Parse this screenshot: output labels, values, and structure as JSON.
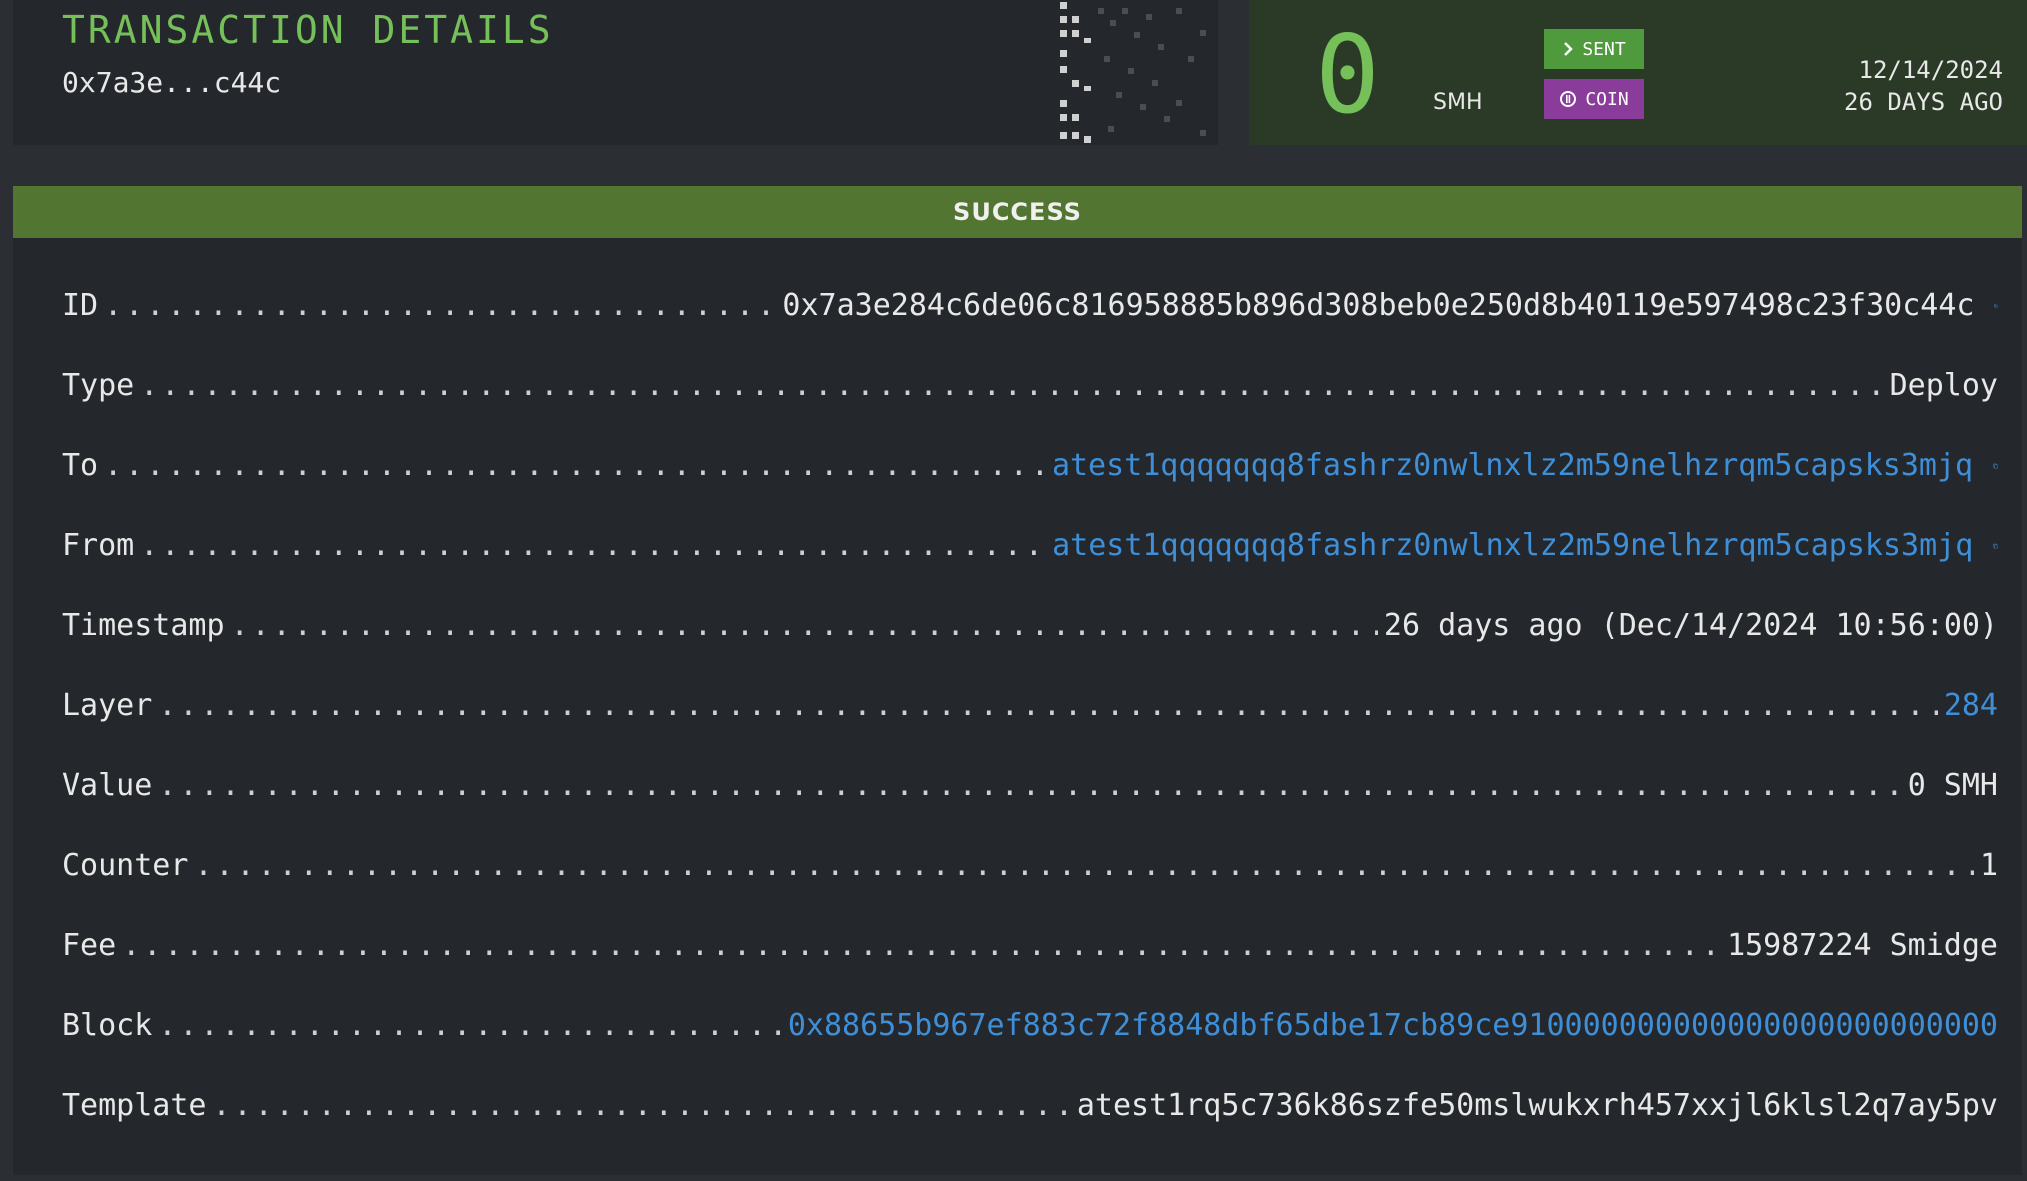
{
  "header": {
    "title": "TRANSACTION DETAILS",
    "short_id": "0x7a3e...c44c",
    "amount": "0",
    "unit": "SMH",
    "badges": {
      "sent": "SENT",
      "coin": "COIN"
    },
    "date": "12/14/2024",
    "age": "26 DAYS AGO"
  },
  "status": "SUCCESS",
  "details": [
    {
      "label": "ID",
      "value": "0x7a3e284c6de06c816958885b896d308beb0e250d8b40119e597498c23f30c44c",
      "link": false,
      "copy": true
    },
    {
      "label": "Type",
      "value": "Deploy",
      "link": false,
      "copy": false
    },
    {
      "label": "To",
      "value": "atest1qqqqqqq8fashrz0nwlnxlz2m59nelhzrqm5capsks3mjq",
      "link": true,
      "copy": true
    },
    {
      "label": "From",
      "value": "atest1qqqqqqq8fashrz0nwlnxlz2m59nelhzrqm5capsks3mjq",
      "link": true,
      "copy": true
    },
    {
      "label": "Timestamp",
      "value": "26 days ago (Dec/14/2024 10:56:00)",
      "link": false,
      "copy": false
    },
    {
      "label": "Layer",
      "value": "284",
      "link": true,
      "copy": false
    },
    {
      "label": "Value",
      "value": "0 SMH",
      "link": false,
      "copy": false
    },
    {
      "label": "Counter",
      "value": "1",
      "link": false,
      "copy": false
    },
    {
      "label": "Fee",
      "value": "15987224 Smidge",
      "link": false,
      "copy": false
    },
    {
      "label": "Block",
      "value": "0x88655b967ef883c72f8848dbf65dbe17cb89ce910000000000000000000000000",
      "link": true,
      "copy": false
    },
    {
      "label": "Template",
      "value": "atest1rq5c736k86szfe50mslwukxrh457xxjl6klsl2q7ay5pv",
      "link": false,
      "copy": false
    }
  ],
  "colors": {
    "accent_green": "#76c05a",
    "link_blue": "#3f8fd8",
    "success_bar": "#527532",
    "sent_badge": "#4f9a3c",
    "coin_badge": "#8a3c9a"
  }
}
